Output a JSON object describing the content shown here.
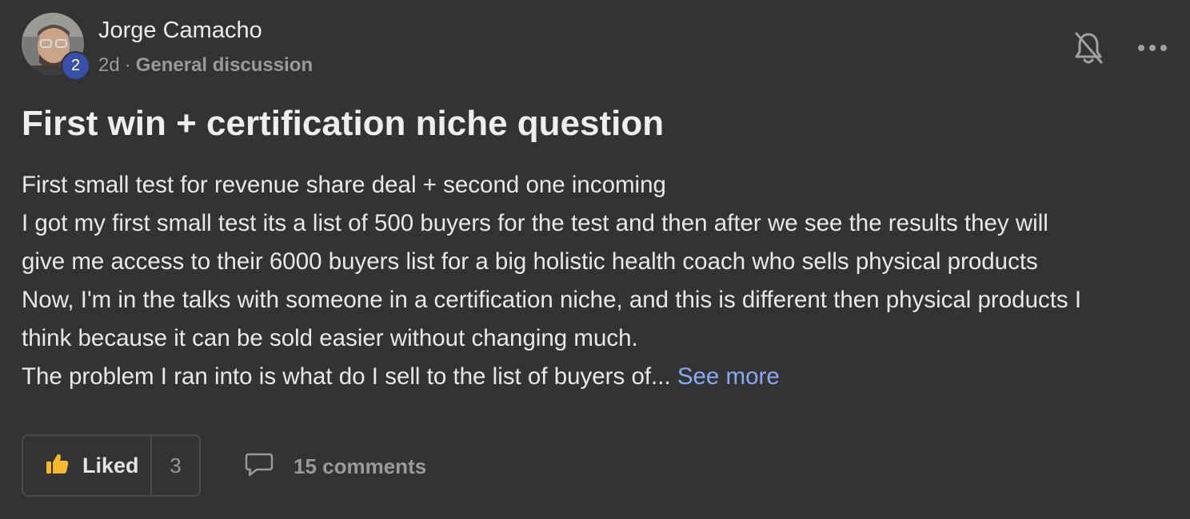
{
  "post": {
    "author": "Jorge Camacho",
    "level": "2",
    "age": "2d",
    "separator": "·",
    "category": "General discussion",
    "title": "First win + certification niche question",
    "body_lines": [
      "First small test for revenue share deal + second one incoming",
      "I got my first small test its a list of 500 buyers for the test and then after we see the results they will",
      "give me access to their 6000 buyers list for a big holistic health coach who sells physical products",
      "Now, I'm in the talks with someone in a certification niche, and this is different then physical products I",
      "think because it can be sold easier without changing much.",
      "The problem I ran into is what do I sell to the list of buyers of..."
    ],
    "see_more": "See more"
  },
  "actions": {
    "like_label": "Liked",
    "like_count": "3",
    "comments_label": "15 comments"
  },
  "icons": {
    "notify": "bell-off-icon",
    "menu": "more-horizontal-icon",
    "like": "thumbs-up-icon",
    "comment": "comment-bubble-icon"
  },
  "colors": {
    "background": "#333333",
    "link": "#8aa9f5",
    "badge": "#3a4fa8",
    "thumb": "#f5b82e",
    "muted": "#9a9a9a"
  }
}
